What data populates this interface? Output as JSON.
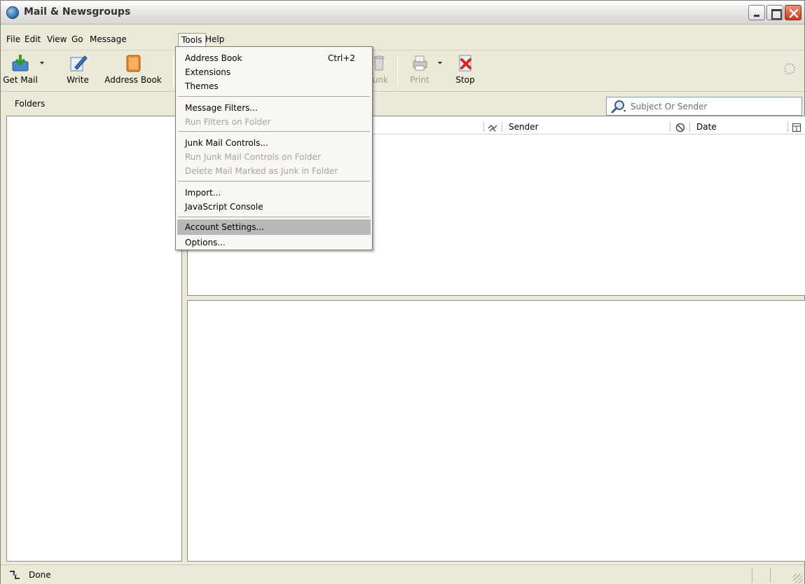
{
  "window": {
    "title": "Mail & Newsgroups",
    "controls": [
      "minimize",
      "maximize",
      "close"
    ]
  },
  "menubar": {
    "items": [
      {
        "id": "file",
        "label": "File"
      },
      {
        "id": "edit",
        "label": "Edit"
      },
      {
        "id": "view",
        "label": "View"
      },
      {
        "id": "go",
        "label": "Go"
      },
      {
        "id": "message",
        "label": "Message"
      },
      {
        "id": "tools",
        "label": "Tools"
      },
      {
        "id": "help",
        "label": "Help"
      }
    ]
  },
  "toolbar": {
    "get_mail": "Get Mail",
    "write": "Write",
    "address_book": "Address Book",
    "junk": "Junk",
    "print": "Print",
    "stop": "Stop"
  },
  "folders": {
    "header": "Folders"
  },
  "search": {
    "placeholder": "Subject Or Sender"
  },
  "thread_columns": {
    "sender": "Sender",
    "date": "Date"
  },
  "tools_menu": {
    "items": [
      {
        "label": "Address Book",
        "shortcut": "Ctrl+2",
        "enabled": true
      },
      {
        "label": "Extensions",
        "enabled": true
      },
      {
        "label": "Themes",
        "enabled": true
      },
      {
        "label": "Message Filters...",
        "enabled": true
      },
      {
        "label": "Run Filters on Folder",
        "enabled": false
      },
      {
        "label": "Junk Mail Controls...",
        "enabled": true
      },
      {
        "label": "Run Junk Mail Controls on Folder",
        "enabled": false
      },
      {
        "label": "Delete Mail Marked as Junk in Folder",
        "enabled": false
      },
      {
        "label": "Import...",
        "enabled": true
      },
      {
        "label": "JavaScript Console",
        "enabled": true
      },
      {
        "label": "Account Settings...",
        "enabled": true,
        "highlighted": true
      },
      {
        "label": "Options...",
        "enabled": true
      }
    ]
  },
  "statusbar": {
    "text": "Done"
  },
  "colors": {
    "chrome": "#ece9d8",
    "menu_highlight": "#b8b8b8",
    "disabled_text": "#a6a49a"
  }
}
